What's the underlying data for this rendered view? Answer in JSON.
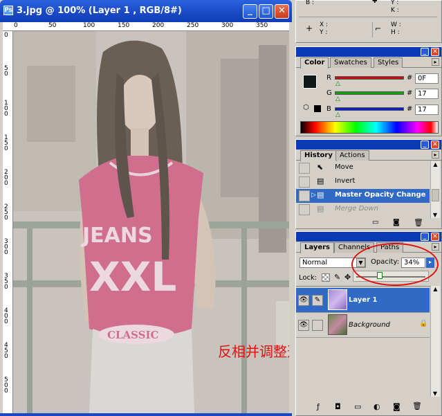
{
  "document": {
    "title": "3.jpg @ 100% (Layer 1 , RGB/8#)",
    "ruler_top": [
      "0",
      "50",
      "100",
      "150",
      "200",
      "250",
      "300",
      "350"
    ],
    "ruler_left": [
      "0",
      "5 0",
      "1 0 0",
      "1 5 0",
      "2 0 0",
      "2 5 0",
      "3 0 0",
      "3 5 0",
      "4 0 0",
      "4 5 0",
      "5 0 0"
    ],
    "controls": {
      "minimize": "_",
      "maximize": "□",
      "close": "✕"
    },
    "caption": "反相并调整透明度",
    "shirt_text": {
      "line1": "JEANS",
      "line2": "XXL",
      "line3": "CLASSIC"
    }
  },
  "info_panel": {
    "b": "B :",
    "y": "Y :",
    "k": "K :",
    "x": "X :",
    "y2": "Y :",
    "w": "W :",
    "h": "H :"
  },
  "color_panel": {
    "tabs": [
      "Color",
      "Swatches",
      "Styles"
    ],
    "channels": [
      {
        "label": "R",
        "value": "0F",
        "color": "#c01010"
      },
      {
        "label": "G",
        "value": "17",
        "color": "#10a010"
      },
      {
        "label": "B",
        "value": "17",
        "color": "#1020c0"
      }
    ],
    "hash": "#"
  },
  "history_panel": {
    "tabs": [
      "History",
      "Actions"
    ],
    "items": [
      "Move",
      "Invert",
      "Master Opacity Change",
      "Merge Down"
    ]
  },
  "layers_panel": {
    "tabs": [
      "Layers",
      "Channels",
      "Paths"
    ],
    "blend_mode": "Normal",
    "opacity_label": "Opacity:",
    "opacity_value": "34%",
    "opacity_level": 0.34,
    "lock_label": "Lock:",
    "layers": [
      {
        "name": "Layer 1",
        "selected": true
      },
      {
        "name": "Background",
        "selected": false,
        "locked": true
      }
    ]
  },
  "colors": {
    "titlebar": "#0a3bb5",
    "selection": "#316ac5",
    "annotation": "#e01010"
  }
}
